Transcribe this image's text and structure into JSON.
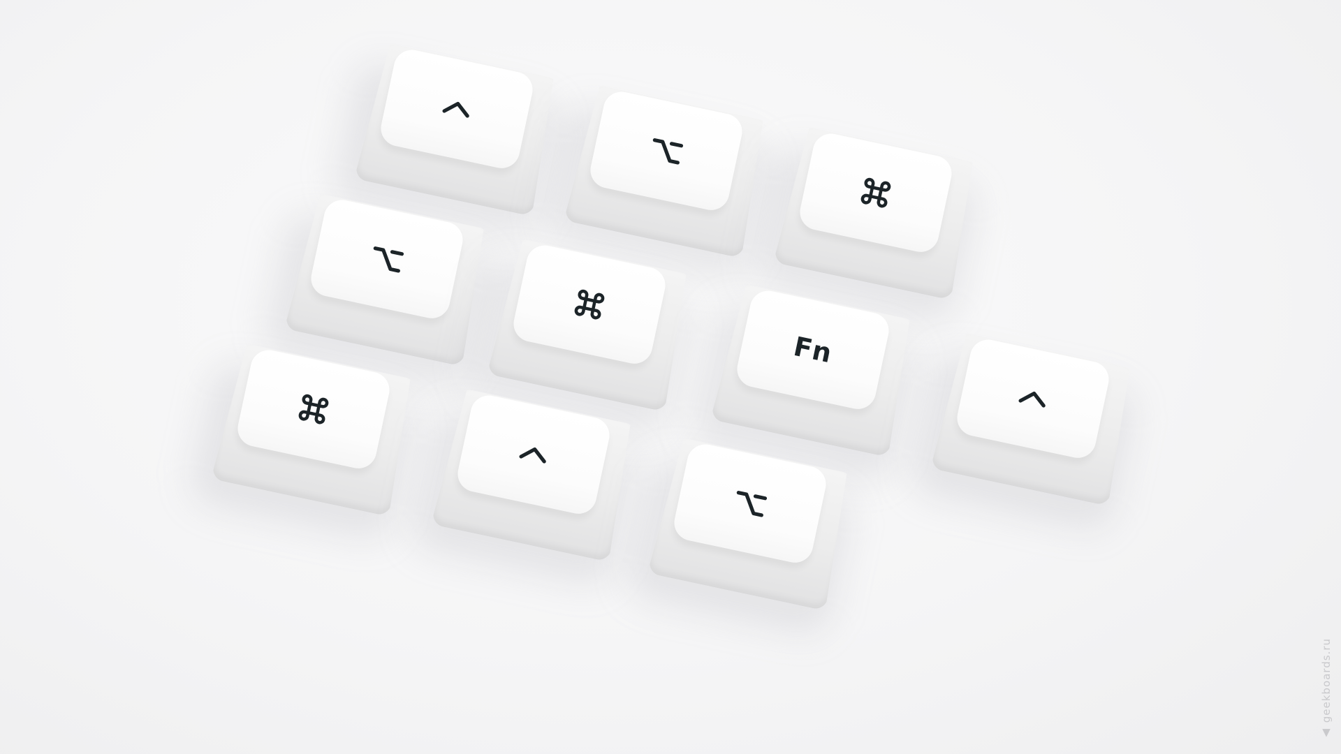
{
  "scene": {
    "background_color": "#f5f5f6",
    "keycap_color": "#ffffff",
    "legend_color": "#1c2428"
  },
  "keycaps": [
    {
      "icon": "control-icon",
      "label": ""
    },
    {
      "icon": "option-icon",
      "label": ""
    },
    {
      "icon": "command-icon",
      "label": ""
    },
    {
      "icon": "option-icon",
      "label": ""
    },
    {
      "icon": "command-icon",
      "label": ""
    },
    {
      "icon": "",
      "label": "Fn"
    },
    {
      "icon": "control-icon",
      "label": ""
    },
    {
      "icon": "command-icon",
      "label": ""
    },
    {
      "icon": "control-icon",
      "label": ""
    },
    {
      "icon": "option-icon",
      "label": ""
    }
  ],
  "watermark": {
    "text": "▲ geekboards.ru"
  }
}
